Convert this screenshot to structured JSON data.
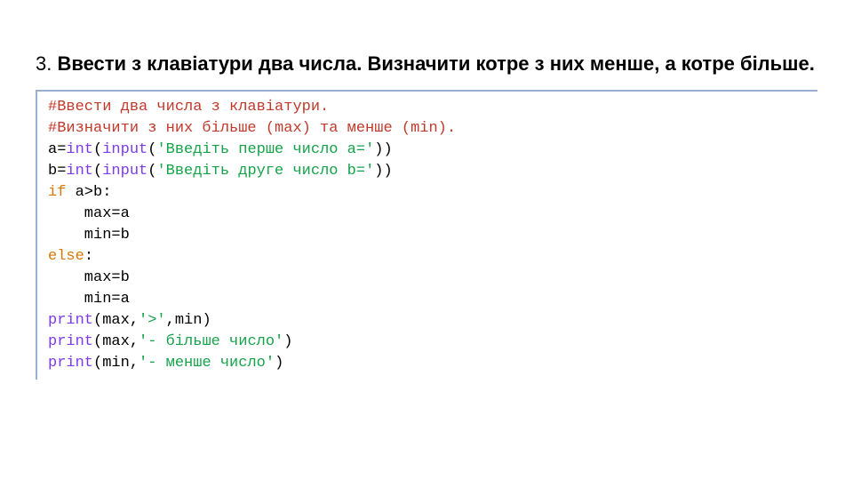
{
  "heading": {
    "num": "3. ",
    "text": "Ввести з клавіатури два числа. Визначити котре з них менше, а котре більше."
  },
  "code": {
    "l1": "#Ввести два числа з клавіатури.",
    "l2": "#Визначити з них більше (max) та менше (min).",
    "l3a": "a=",
    "l3b": "int",
    "l3c": "(",
    "l3d": "input",
    "l3e": "(",
    "l3f": "'Введіть перше число a='",
    "l3g": "))",
    "l4a": "b=",
    "l4b": "int",
    "l4c": "(",
    "l4d": "input",
    "l4e": "(",
    "l4f": "'Введіть друге число b='",
    "l4g": "))",
    "l5a": "if",
    "l5b": " a>b:",
    "l6": "    max=a",
    "l7": "    min=b",
    "l8a": "else",
    "l8b": ":",
    "l9": "    max=b",
    "l10": "    min=a",
    "l11a": "print",
    "l11b": "(max,",
    "l11c": "'>'",
    "l11d": ",min)",
    "l12a": "print",
    "l12b": "(max,",
    "l12c": "'- більше число'",
    "l12d": ")",
    "l13a": "print",
    "l13b": "(min,",
    "l13c": "'- менше число'",
    "l13d": ")"
  }
}
